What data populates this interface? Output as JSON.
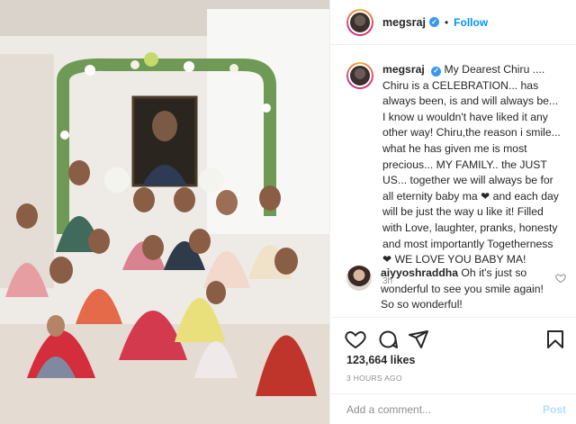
{
  "post": {
    "photo_alt_icon": "group-photo",
    "author": {
      "username": "megsraj",
      "verified_icon": "verified-badge-icon",
      "follow_label": "Follow",
      "separator": "•"
    },
    "caption": {
      "username": "megsraj",
      "text": "My Dearest Chiru .... Chiru is a CELEBRATION... has always been, is and will always be... I know u wouldn't have liked it any other way! Chiru,the reason i smile... what he has given me is most precious... MY FAMILY.. the JUST US... together we will always be for all eternity baby ma ❤ and each day will be just the way u like it! Filled with Love, laughter, pranks, honesty and most importantly Togetherness ❤ WE LOVE YOU BABY MA!",
      "time": "3h"
    },
    "comment": {
      "username": "aiyyoshraddha",
      "text": "Oh it's just so wonderful to see you smile again! So so wonderful!"
    },
    "actions": {
      "like_icon": "heart-icon",
      "comment_icon": "comment-icon",
      "share_icon": "send-icon",
      "save_icon": "bookmark-icon"
    },
    "likes_label": "123,664 likes",
    "posted_ago": "3 HOURS AGO",
    "add_comment": {
      "placeholder": "Add a comment...",
      "post_label": "Post"
    },
    "colors": {
      "link_blue": "#0095f6",
      "verified_blue": "#3897f0",
      "muted": "#8e8e8e",
      "post_disabled": "#b2dffc"
    }
  }
}
